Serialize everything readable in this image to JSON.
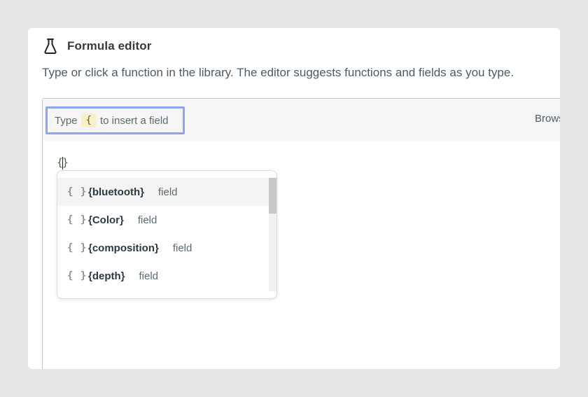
{
  "panel": {
    "title": "Formula editor",
    "title_icon": "flask-icon",
    "description": "Type or click a function in the library. The editor suggests functions and fields as you type."
  },
  "toolbar": {
    "hint_prefix": "Type",
    "hint_key": "{",
    "hint_suffix": "to insert a field",
    "browse_label": "Browse"
  },
  "editor": {
    "open_brace": "{",
    "close_brace": "}"
  },
  "autocomplete": {
    "items": [
      {
        "icon": "{ }",
        "name": "{bluetooth}",
        "type": "field",
        "active": true
      },
      {
        "icon": "{ }",
        "name": "{Color}",
        "type": "field",
        "active": false
      },
      {
        "icon": "{ }",
        "name": "{composition}",
        "type": "field",
        "active": false
      },
      {
        "icon": "{ }",
        "name": "{depth}",
        "type": "field",
        "active": false
      }
    ]
  },
  "colors": {
    "background": "#e6e6e6",
    "hint_border": "#8fa3ee",
    "brace_chip": "#f9efc9"
  }
}
